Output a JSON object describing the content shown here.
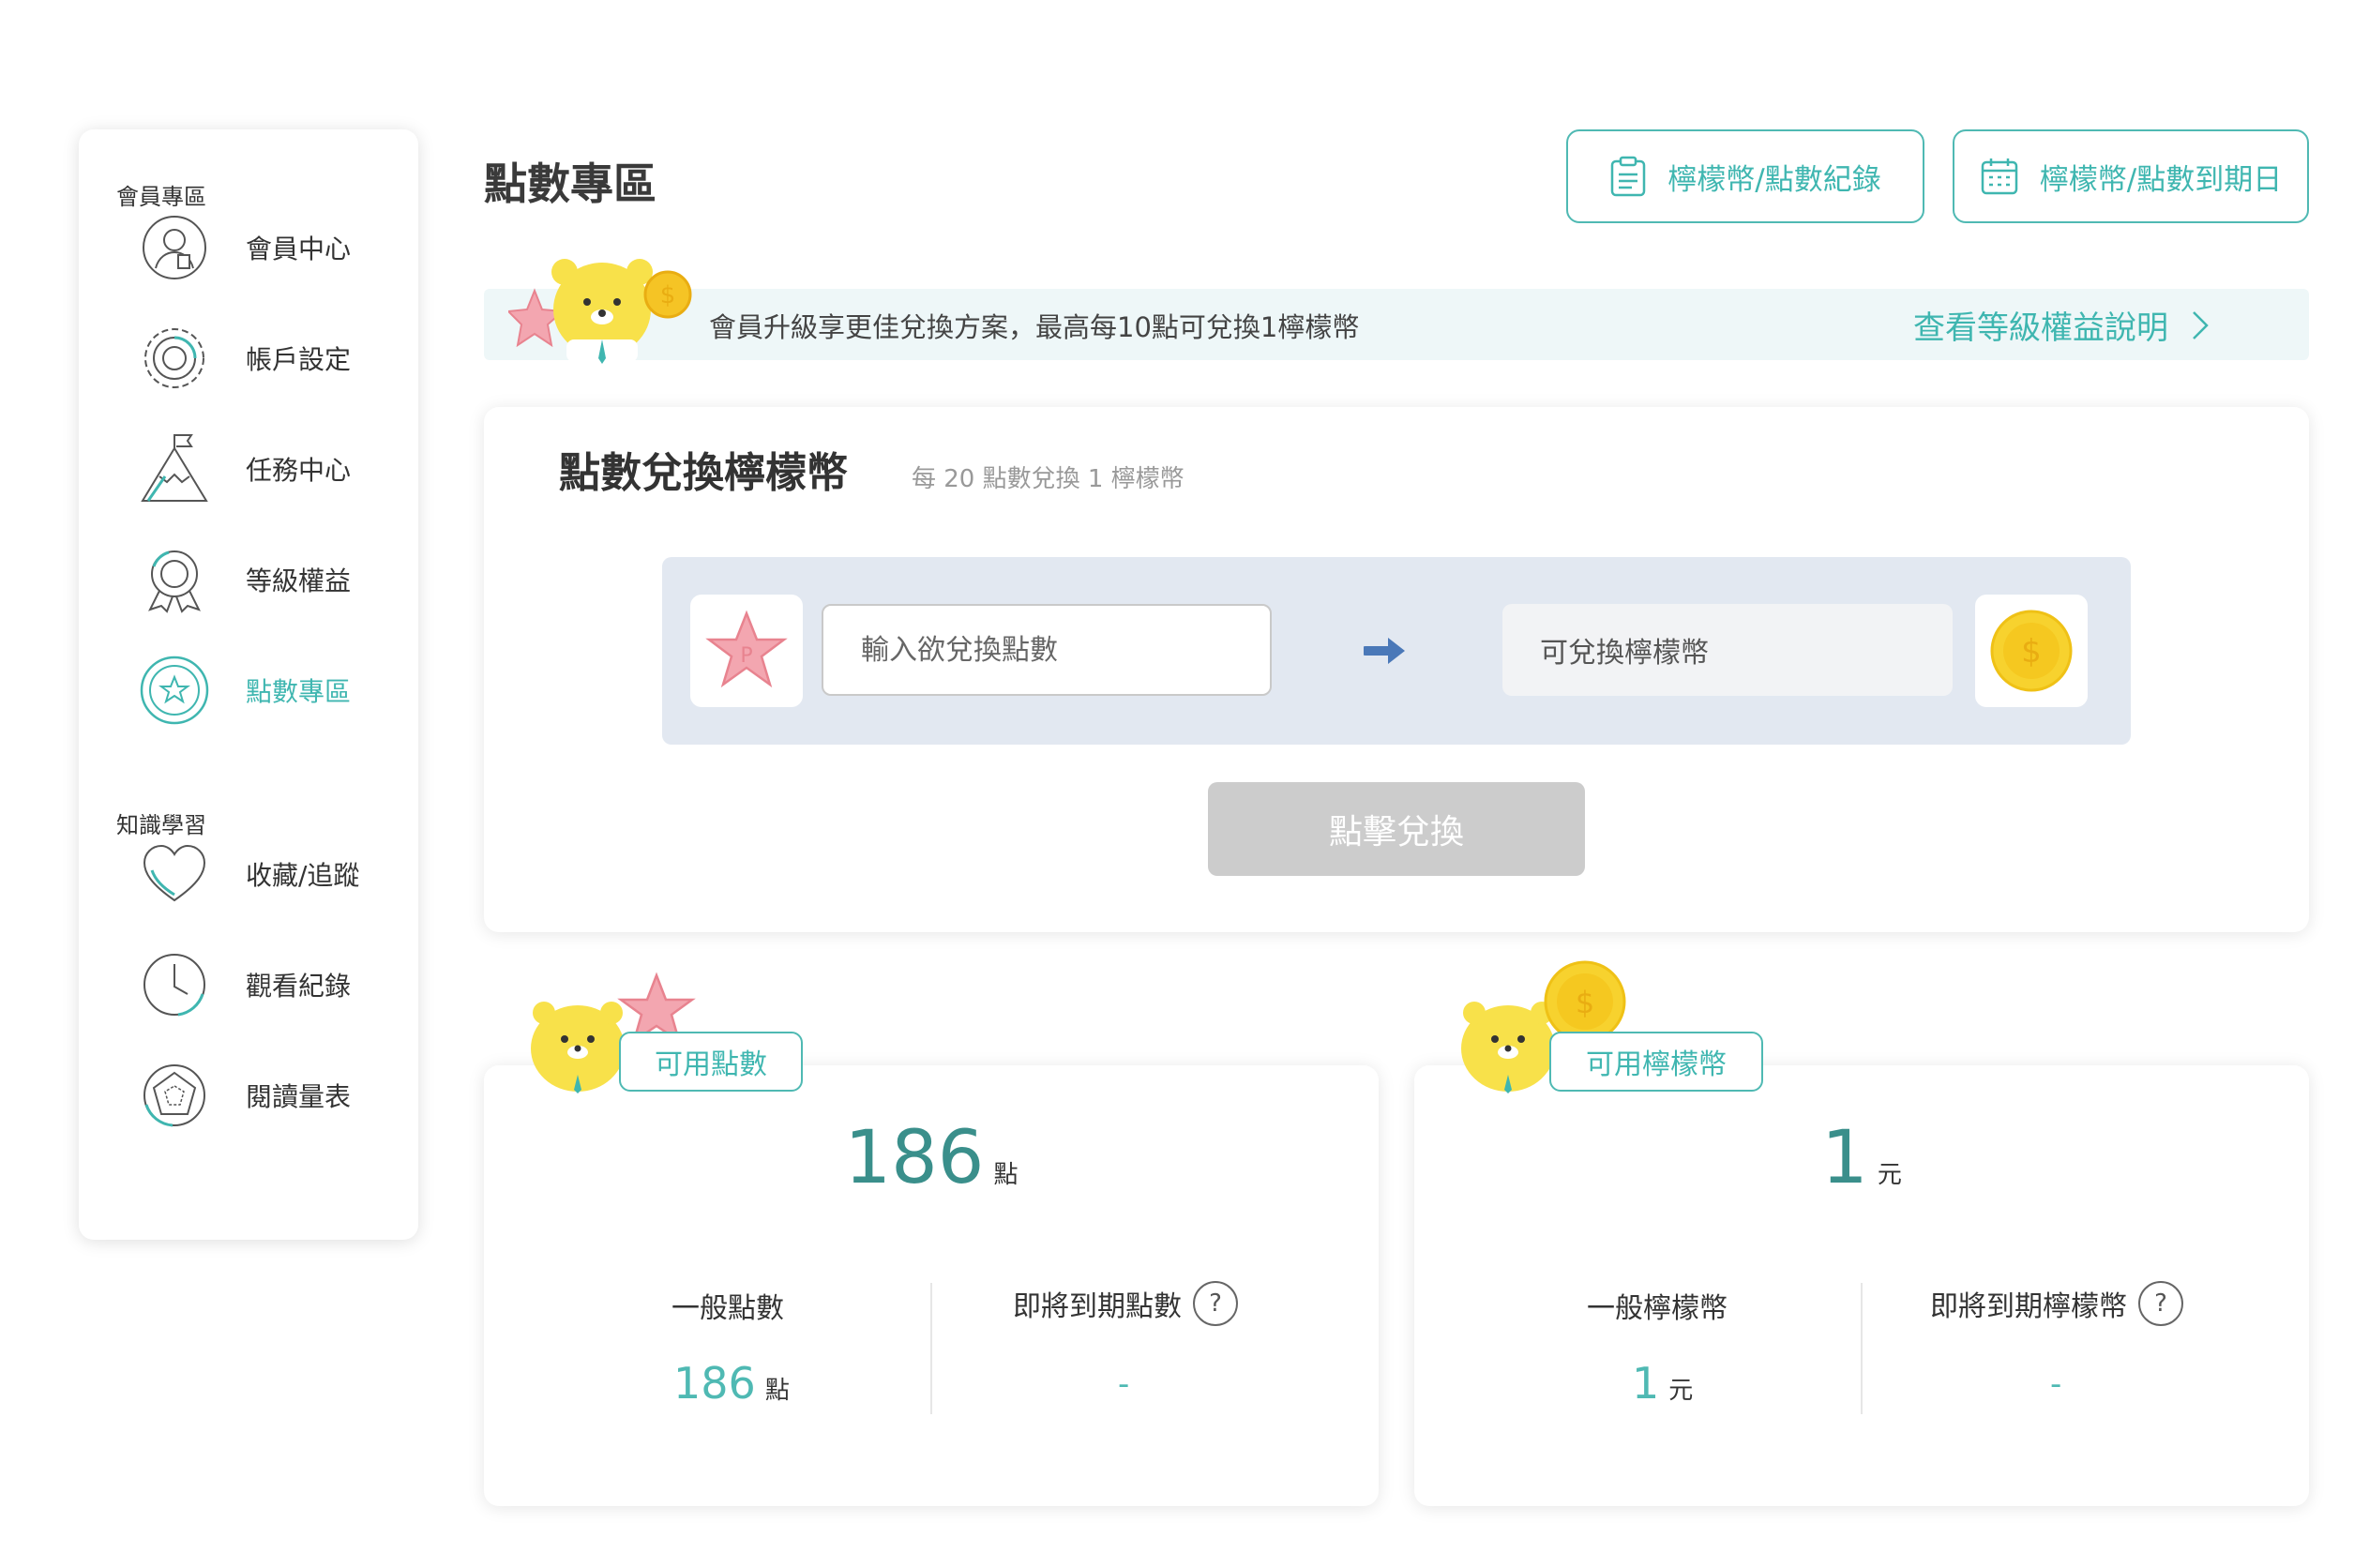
{
  "sidebar": {
    "section_member": "會員專區",
    "section_learning": "知識學習",
    "items": [
      {
        "label": "會員中心"
      },
      {
        "label": "帳戶設定"
      },
      {
        "label": "任務中心"
      },
      {
        "label": "等級權益"
      },
      {
        "label": "點數專區"
      },
      {
        "label": "收藏/追蹤"
      },
      {
        "label": "觀看紀錄"
      },
      {
        "label": "閱讀量表"
      }
    ],
    "active_item": "點數專區"
  },
  "header": {
    "title": "點數專區",
    "records_button": "檸檬幣/點數紀錄",
    "expiry_button": "檸檬幣/點數到期日"
  },
  "banner": {
    "text": "會員升級享更佳兌換方案，最高每10點可兌換1檸檬幣",
    "link": "查看等級權益說明"
  },
  "exchange": {
    "title": "點數兌換檸檬幣",
    "subtitle": "每 20 點數兌換 1 檸檬幣",
    "input_placeholder": "輸入欲兌換點數",
    "output_label": "可兌換檸檬幣",
    "submit": "點擊兌換"
  },
  "points_card": {
    "tab": "可用點數",
    "total": "186",
    "total_unit": "點",
    "general_title": "一般點數",
    "general_value": "186",
    "general_unit": "點",
    "expiring_title": "即將到期點數",
    "expiring_value": "-"
  },
  "coins_card": {
    "tab": "可用檸檬幣",
    "total": "1",
    "total_unit": "元",
    "general_title": "一般檸檬幣",
    "general_value": "1",
    "general_unit": "元",
    "expiring_title": "即將到期檸檬幣",
    "expiring_value": "-"
  },
  "colors": {
    "accent": "#3fb6b0",
    "big_number": "#3a8f8b",
    "panel": "#e2e8f1",
    "banner": "#eef7f8",
    "disabled_button": "#cccccc"
  }
}
